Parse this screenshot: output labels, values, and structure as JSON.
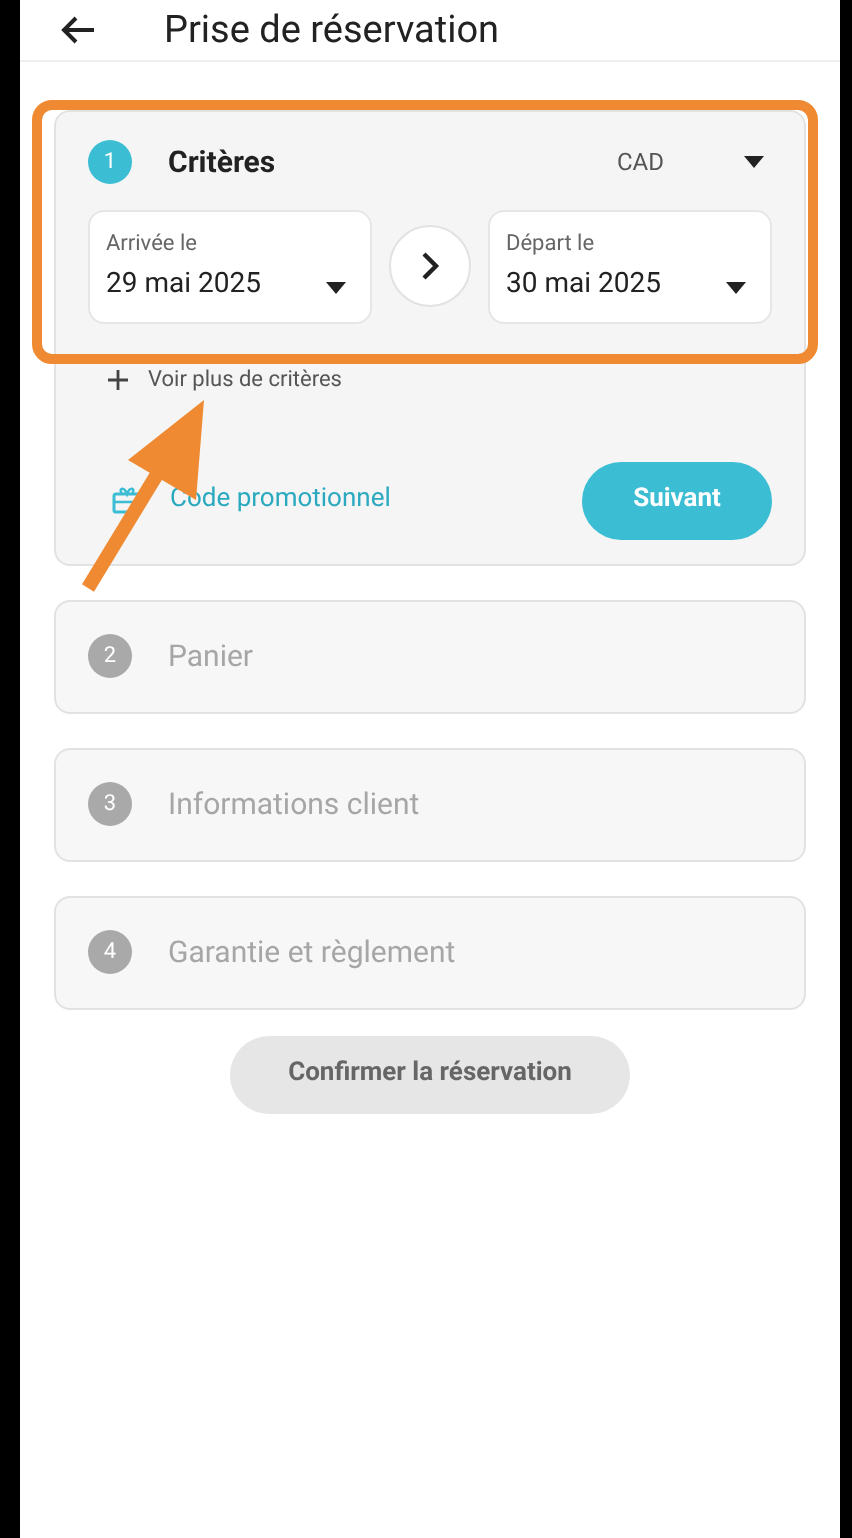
{
  "header": {
    "title": "Prise de réservation"
  },
  "steps": [
    {
      "number": "1",
      "title": "Critères",
      "active": true
    },
    {
      "number": "2",
      "title": "Panier",
      "active": false
    },
    {
      "number": "3",
      "title": "Informations client",
      "active": false
    },
    {
      "number": "4",
      "title": "Garantie et règlement",
      "active": false
    }
  ],
  "criteria": {
    "currency": "CAD",
    "arrival": {
      "label": "Arrivée le",
      "value": "29 mai 2025"
    },
    "departure": {
      "label": "Départ le",
      "value": "30 mai 2025"
    },
    "more": "Voir plus de critères",
    "promo": "Code promotionnel",
    "next": "Suivant"
  },
  "confirm": {
    "label": "Confirmer la réservation",
    "disabled": true
  }
}
